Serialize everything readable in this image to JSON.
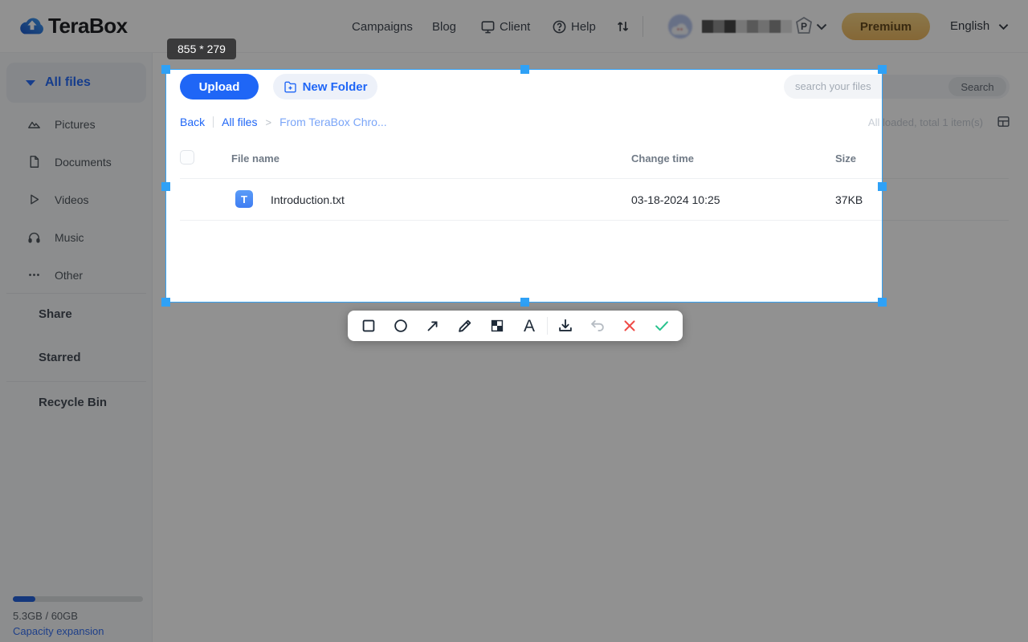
{
  "header": {
    "brand": "TeraBox",
    "nav": [
      {
        "label": "Campaigns"
      },
      {
        "label": "Blog"
      },
      {
        "label": "Client"
      },
      {
        "label": "Help"
      }
    ],
    "premium_badge": "P",
    "premium_label": "Premium",
    "language": "English"
  },
  "sidebar": {
    "items": [
      {
        "label": "All files"
      },
      {
        "label": "Pictures"
      },
      {
        "label": "Documents"
      },
      {
        "label": "Videos"
      },
      {
        "label": "Music"
      },
      {
        "label": "Other"
      }
    ],
    "links": [
      {
        "label": "Share"
      },
      {
        "label": "Starred"
      },
      {
        "label": "Recycle Bin"
      }
    ],
    "storage": {
      "usage": "5.3GB / 60GB",
      "link": "Capacity expansion"
    }
  },
  "main": {
    "upload": "Upload",
    "new_folder": "New Folder",
    "search_placeholder": "search your files",
    "search_button": "Search",
    "breadcrumb": {
      "back": "Back",
      "root": "All files",
      "separator": ">",
      "current": "From TeraBox Chro..."
    },
    "status": "All loaded, total 1 item(s)",
    "table": {
      "col_name": "File name",
      "col_time": "Change time",
      "col_size": "Size",
      "rows": [
        {
          "name": "Introduction.txt",
          "time": "03-18-2024 10:25",
          "size": "37KB",
          "icon_glyph": "T"
        }
      ]
    }
  },
  "capture": {
    "dimensions": "855 * 279",
    "text_tool_glyph": "A"
  },
  "colors": {
    "accent": "#1f66f6",
    "selection_blue": "#2fa1f6",
    "premium_gold": "#e9b35a",
    "cancel_red": "#ef4b47",
    "confirm_green": "#27c28d"
  }
}
